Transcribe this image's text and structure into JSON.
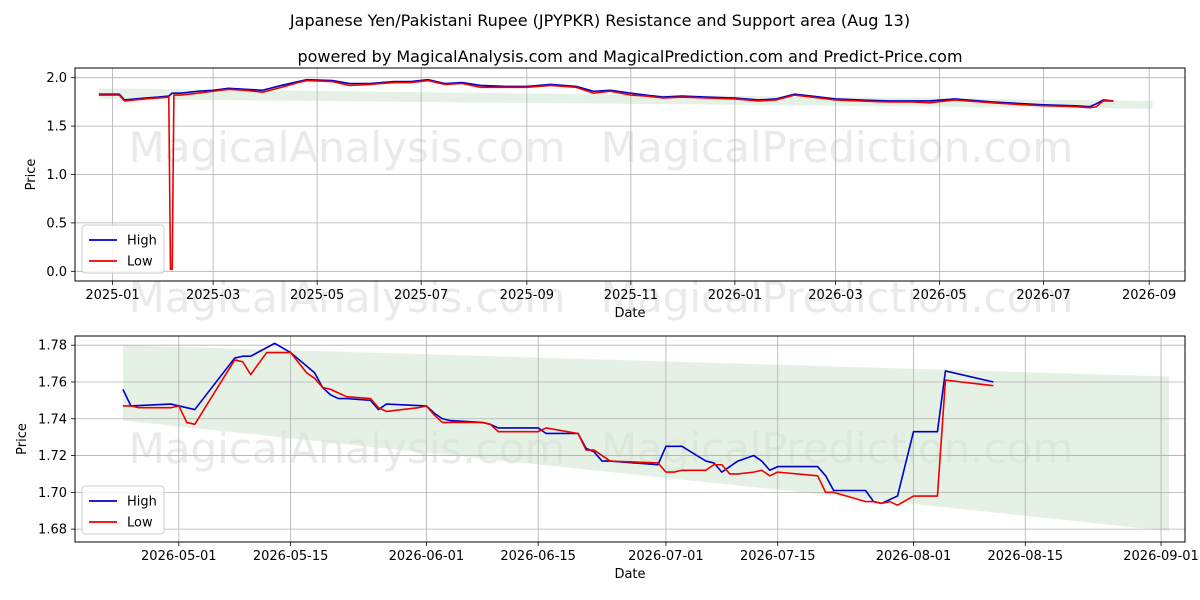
{
  "title": "Japanese Yen/Pakistani Rupee (JPYPKR) Resistance and Support area (Aug 13)",
  "subtitle": "powered by MagicalAnalysis.com and MagicalPrediction.com and Predict-Price.com",
  "watermarks": [
    "MagicalAnalysis.com",
    "MagicalPrediction.com"
  ],
  "colors": {
    "high": "#0000cc",
    "low": "#ee0000",
    "band": "#cfe6cf",
    "grid": "#b0b0b0"
  },
  "chart_data": [
    {
      "type": "line",
      "xlabel": "Date",
      "ylabel": "Price",
      "xlim": [
        "2024-12-10",
        "2026-09-22"
      ],
      "ylim": [
        -0.1,
        2.1
      ],
      "grid": true,
      "legend": "lower-left",
      "x_ticks": [
        "2025-01-01",
        "2025-03-01",
        "2025-05-01",
        "2025-07-01",
        "2025-09-01",
        "2025-11-01",
        "2026-01-01",
        "2026-03-01",
        "2026-05-01",
        "2026-07-01",
        "2026-09-01"
      ],
      "x_tick_labels": [
        "2025-01",
        "2025-03",
        "2025-05",
        "2025-07",
        "2025-09",
        "2025-11",
        "2026-01",
        "2026-03",
        "2026-05",
        "2026-07",
        "2026-09"
      ],
      "y_ticks": [
        0.0,
        0.5,
        1.0,
        1.5,
        2.0
      ],
      "y_tick_labels": [
        "0.0",
        "0.5",
        "1.0",
        "1.5",
        "2.0"
      ],
      "band": {
        "x": [
          "2024-12-24",
          "2026-09-03"
        ],
        "upper": [
          1.89,
          1.76
        ],
        "lower": [
          1.78,
          1.68
        ]
      },
      "series": [
        {
          "name": "High",
          "color": "#0000cc",
          "x": [
            "2024-12-24",
            "2025-01-05",
            "2025-01-08",
            "2025-01-20",
            "2025-01-28",
            "2025-02-03",
            "2025-02-05",
            "2025-02-10",
            "2025-02-20",
            "2025-03-01",
            "2025-03-10",
            "2025-03-20",
            "2025-03-30",
            "2025-04-10",
            "2025-04-20",
            "2025-04-25",
            "2025-05-10",
            "2025-05-20",
            "2025-06-01",
            "2025-06-15",
            "2025-06-25",
            "2025-07-05",
            "2025-07-15",
            "2025-07-25",
            "2025-08-05",
            "2025-08-20",
            "2025-09-01",
            "2025-09-15",
            "2025-09-30",
            "2025-10-10",
            "2025-10-20",
            "2025-11-01",
            "2025-11-10",
            "2025-11-20",
            "2025-12-01",
            "2025-12-15",
            "2026-01-01",
            "2026-01-15",
            "2026-01-25",
            "2026-02-05",
            "2026-02-15",
            "2026-03-01",
            "2026-03-15",
            "2026-04-01",
            "2026-04-15",
            "2026-04-25",
            "2026-05-10",
            "2026-06-01",
            "2026-06-20",
            "2026-07-01",
            "2026-07-20",
            "2026-07-28",
            "2026-08-01",
            "2026-08-05",
            "2026-08-11"
          ],
          "y": [
            1.83,
            1.83,
            1.77,
            1.79,
            1.8,
            1.81,
            1.84,
            1.84,
            1.86,
            1.87,
            1.89,
            1.88,
            1.87,
            1.92,
            1.96,
            1.98,
            1.97,
            1.94,
            1.94,
            1.96,
            1.96,
            1.98,
            1.94,
            1.95,
            1.92,
            1.91,
            1.91,
            1.93,
            1.91,
            1.86,
            1.87,
            1.84,
            1.82,
            1.8,
            1.81,
            1.8,
            1.79,
            1.77,
            1.78,
            1.83,
            1.81,
            1.78,
            1.77,
            1.76,
            1.76,
            1.76,
            1.78,
            1.75,
            1.73,
            1.72,
            1.71,
            1.7,
            1.73,
            1.77,
            1.76
          ]
        },
        {
          "name": "Low",
          "color": "#ee0000",
          "x": [
            "2024-12-24",
            "2025-01-05",
            "2025-01-08",
            "2025-01-20",
            "2025-01-28",
            "2025-02-03",
            "2025-02-04",
            "2025-02-05",
            "2025-02-06",
            "2025-02-10",
            "2025-02-20",
            "2025-03-01",
            "2025-03-10",
            "2025-03-20",
            "2025-03-30",
            "2025-04-10",
            "2025-04-20",
            "2025-04-25",
            "2025-05-10",
            "2025-05-20",
            "2025-06-01",
            "2025-06-15",
            "2025-06-25",
            "2025-07-05",
            "2025-07-15",
            "2025-07-25",
            "2025-08-05",
            "2025-08-20",
            "2025-09-01",
            "2025-09-15",
            "2025-09-30",
            "2025-10-10",
            "2025-10-20",
            "2025-11-01",
            "2025-11-10",
            "2025-11-20",
            "2025-12-01",
            "2025-12-15",
            "2026-01-01",
            "2026-01-15",
            "2026-01-25",
            "2026-02-05",
            "2026-02-15",
            "2026-03-01",
            "2026-03-15",
            "2026-04-01",
            "2026-04-15",
            "2026-04-25",
            "2026-05-10",
            "2026-06-01",
            "2026-06-20",
            "2026-07-01",
            "2026-07-20",
            "2026-07-28",
            "2026-08-01",
            "2026-08-05",
            "2026-08-11"
          ],
          "y": [
            1.82,
            1.82,
            1.76,
            1.78,
            1.79,
            1.8,
            0.02,
            0.02,
            1.82,
            1.82,
            1.84,
            1.86,
            1.88,
            1.87,
            1.85,
            1.9,
            1.95,
            1.97,
            1.96,
            1.92,
            1.93,
            1.95,
            1.95,
            1.97,
            1.93,
            1.94,
            1.9,
            1.9,
            1.9,
            1.92,
            1.9,
            1.84,
            1.86,
            1.82,
            1.81,
            1.79,
            1.8,
            1.79,
            1.78,
            1.76,
            1.77,
            1.82,
            1.8,
            1.77,
            1.76,
            1.75,
            1.75,
            1.74,
            1.77,
            1.74,
            1.72,
            1.71,
            1.7,
            1.69,
            1.7,
            1.76,
            1.76
          ]
        }
      ]
    },
    {
      "type": "line",
      "xlabel": "Date",
      "ylabel": "Price",
      "xlim": [
        "2026-04-18",
        "2026-09-04"
      ],
      "ylim": [
        1.673,
        1.785
      ],
      "grid": true,
      "legend": "lower-left",
      "x_ticks": [
        "2026-05-01",
        "2026-05-15",
        "2026-06-01",
        "2026-06-15",
        "2026-07-01",
        "2026-07-15",
        "2026-08-01",
        "2026-08-15",
        "2026-09-01"
      ],
      "x_tick_labels": [
        "2026-05-01",
        "2026-05-15",
        "2026-06-01",
        "2026-06-15",
        "2026-07-01",
        "2026-07-15",
        "2026-08-01",
        "2026-08-15",
        "2026-09-01"
      ],
      "y_ticks": [
        1.68,
        1.7,
        1.72,
        1.74,
        1.76,
        1.78
      ],
      "y_tick_labels": [
        "1.68",
        "1.70",
        "1.72",
        "1.74",
        "1.76",
        "1.78"
      ],
      "band": {
        "x": [
          "2026-04-24",
          "2026-09-02"
        ],
        "upper": [
          1.78,
          1.763
        ],
        "lower": [
          1.739,
          1.679
        ]
      },
      "series": [
        {
          "name": "High",
          "color": "#0000cc",
          "x": [
            "2026-04-24",
            "2026-04-25",
            "2026-04-30",
            "2026-05-03",
            "2026-05-08",
            "2026-05-09",
            "2026-05-10",
            "2026-05-13",
            "2026-05-15",
            "2026-05-18",
            "2026-05-19",
            "2026-05-20",
            "2026-05-21",
            "2026-05-22",
            "2026-05-25",
            "2026-05-26",
            "2026-05-27",
            "2026-06-01",
            "2026-06-02",
            "2026-06-03",
            "2026-06-04",
            "2026-06-08",
            "2026-06-09",
            "2026-06-10",
            "2026-06-15",
            "2026-06-16",
            "2026-06-20",
            "2026-06-21",
            "2026-06-22",
            "2026-06-23",
            "2026-06-24",
            "2026-06-30",
            "2026-07-01",
            "2026-07-02",
            "2026-07-03",
            "2026-07-06",
            "2026-07-07",
            "2026-07-08",
            "2026-07-09",
            "2026-07-10",
            "2026-07-12",
            "2026-07-13",
            "2026-07-14",
            "2026-07-15",
            "2026-07-20",
            "2026-07-21",
            "2026-07-22",
            "2026-07-26",
            "2026-07-27",
            "2026-07-28",
            "2026-07-29",
            "2026-07-30",
            "2026-08-01",
            "2026-08-02",
            "2026-08-03",
            "2026-08-04",
            "2026-08-05",
            "2026-08-11"
          ],
          "y": [
            1.756,
            1.747,
            1.748,
            1.745,
            1.773,
            1.774,
            1.774,
            1.781,
            1.776,
            1.765,
            1.757,
            1.753,
            1.751,
            1.751,
            1.75,
            1.745,
            1.748,
            1.747,
            1.743,
            1.74,
            1.739,
            1.738,
            1.737,
            1.735,
            1.735,
            1.732,
            1.732,
            1.724,
            1.722,
            1.717,
            1.717,
            1.715,
            1.725,
            1.725,
            1.725,
            1.717,
            1.716,
            1.711,
            1.714,
            1.717,
            1.72,
            1.717,
            1.712,
            1.714,
            1.714,
            1.709,
            1.701,
            1.701,
            1.695,
            1.694,
            1.696,
            1.698,
            1.733,
            1.733,
            1.733,
            1.733,
            1.766,
            1.76
          ]
        },
        {
          "name": "Low",
          "color": "#ee0000",
          "x": [
            "2026-04-24",
            "2026-04-25",
            "2026-04-26",
            "2026-04-30",
            "2026-05-01",
            "2026-05-02",
            "2026-05-03",
            "2026-05-08",
            "2026-05-09",
            "2026-05-10",
            "2026-05-12",
            "2026-05-13",
            "2026-05-15",
            "2026-05-17",
            "2026-05-18",
            "2026-05-19",
            "2026-05-20",
            "2026-05-21",
            "2026-05-22",
            "2026-05-25",
            "2026-05-26",
            "2026-05-27",
            "2026-05-31",
            "2026-06-01",
            "2026-06-02",
            "2026-06-03",
            "2026-06-04",
            "2026-06-08",
            "2026-06-09",
            "2026-06-10",
            "2026-06-15",
            "2026-06-16",
            "2026-06-20",
            "2026-06-21",
            "2026-06-22",
            "2026-06-23",
            "2026-06-24",
            "2026-06-30",
            "2026-07-01",
            "2026-07-02",
            "2026-07-03",
            "2026-07-06",
            "2026-07-07",
            "2026-07-08",
            "2026-07-09",
            "2026-07-10",
            "2026-07-12",
            "2026-07-13",
            "2026-07-14",
            "2026-07-15",
            "2026-07-20",
            "2026-07-21",
            "2026-07-22",
            "2026-07-26",
            "2026-07-27",
            "2026-07-28",
            "2026-07-29",
            "2026-07-30",
            "2026-08-01",
            "2026-08-02",
            "2026-08-03",
            "2026-08-04",
            "2026-08-05",
            "2026-08-11"
          ],
          "y": [
            1.747,
            1.747,
            1.746,
            1.746,
            1.747,
            1.738,
            1.737,
            1.772,
            1.771,
            1.764,
            1.776,
            1.776,
            1.776,
            1.765,
            1.762,
            1.757,
            1.756,
            1.754,
            1.752,
            1.751,
            1.746,
            1.744,
            1.746,
            1.747,
            1.742,
            1.738,
            1.738,
            1.738,
            1.737,
            1.733,
            1.733,
            1.735,
            1.732,
            1.723,
            1.723,
            1.72,
            1.717,
            1.716,
            1.711,
            1.711,
            1.712,
            1.712,
            1.715,
            1.715,
            1.71,
            1.71,
            1.711,
            1.712,
            1.709,
            1.711,
            1.709,
            1.7,
            1.7,
            1.695,
            1.695,
            1.694,
            1.695,
            1.693,
            1.698,
            1.698,
            1.698,
            1.698,
            1.761,
            1.758
          ]
        }
      ]
    }
  ]
}
